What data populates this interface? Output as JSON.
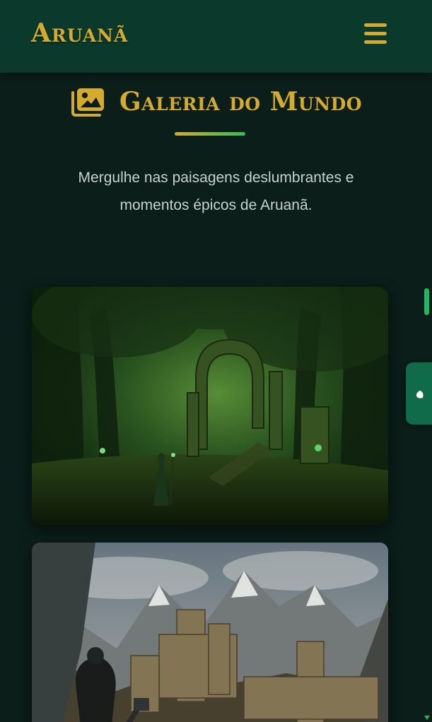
{
  "header": {
    "logo": "Aruanã",
    "menu_icon": "hamburger-menu-icon"
  },
  "gallery": {
    "title": "Galeria do Mundo",
    "icon": "images-icon",
    "description": "Mergulhe nas paisagens deslumbrantes e momentos épicos de Aruanã.",
    "items": [
      {
        "scene": "forest-ruins-image"
      },
      {
        "scene": "mountain-fortress-image"
      }
    ]
  },
  "side_tab": {
    "icon": "leaf-icon"
  },
  "colors": {
    "header_bg": "#0b3a2c",
    "page_bg": "#0b1e19",
    "gold": "#d4aa2f",
    "accent_green": "#22b660",
    "text_light": "#c8d2cc"
  }
}
